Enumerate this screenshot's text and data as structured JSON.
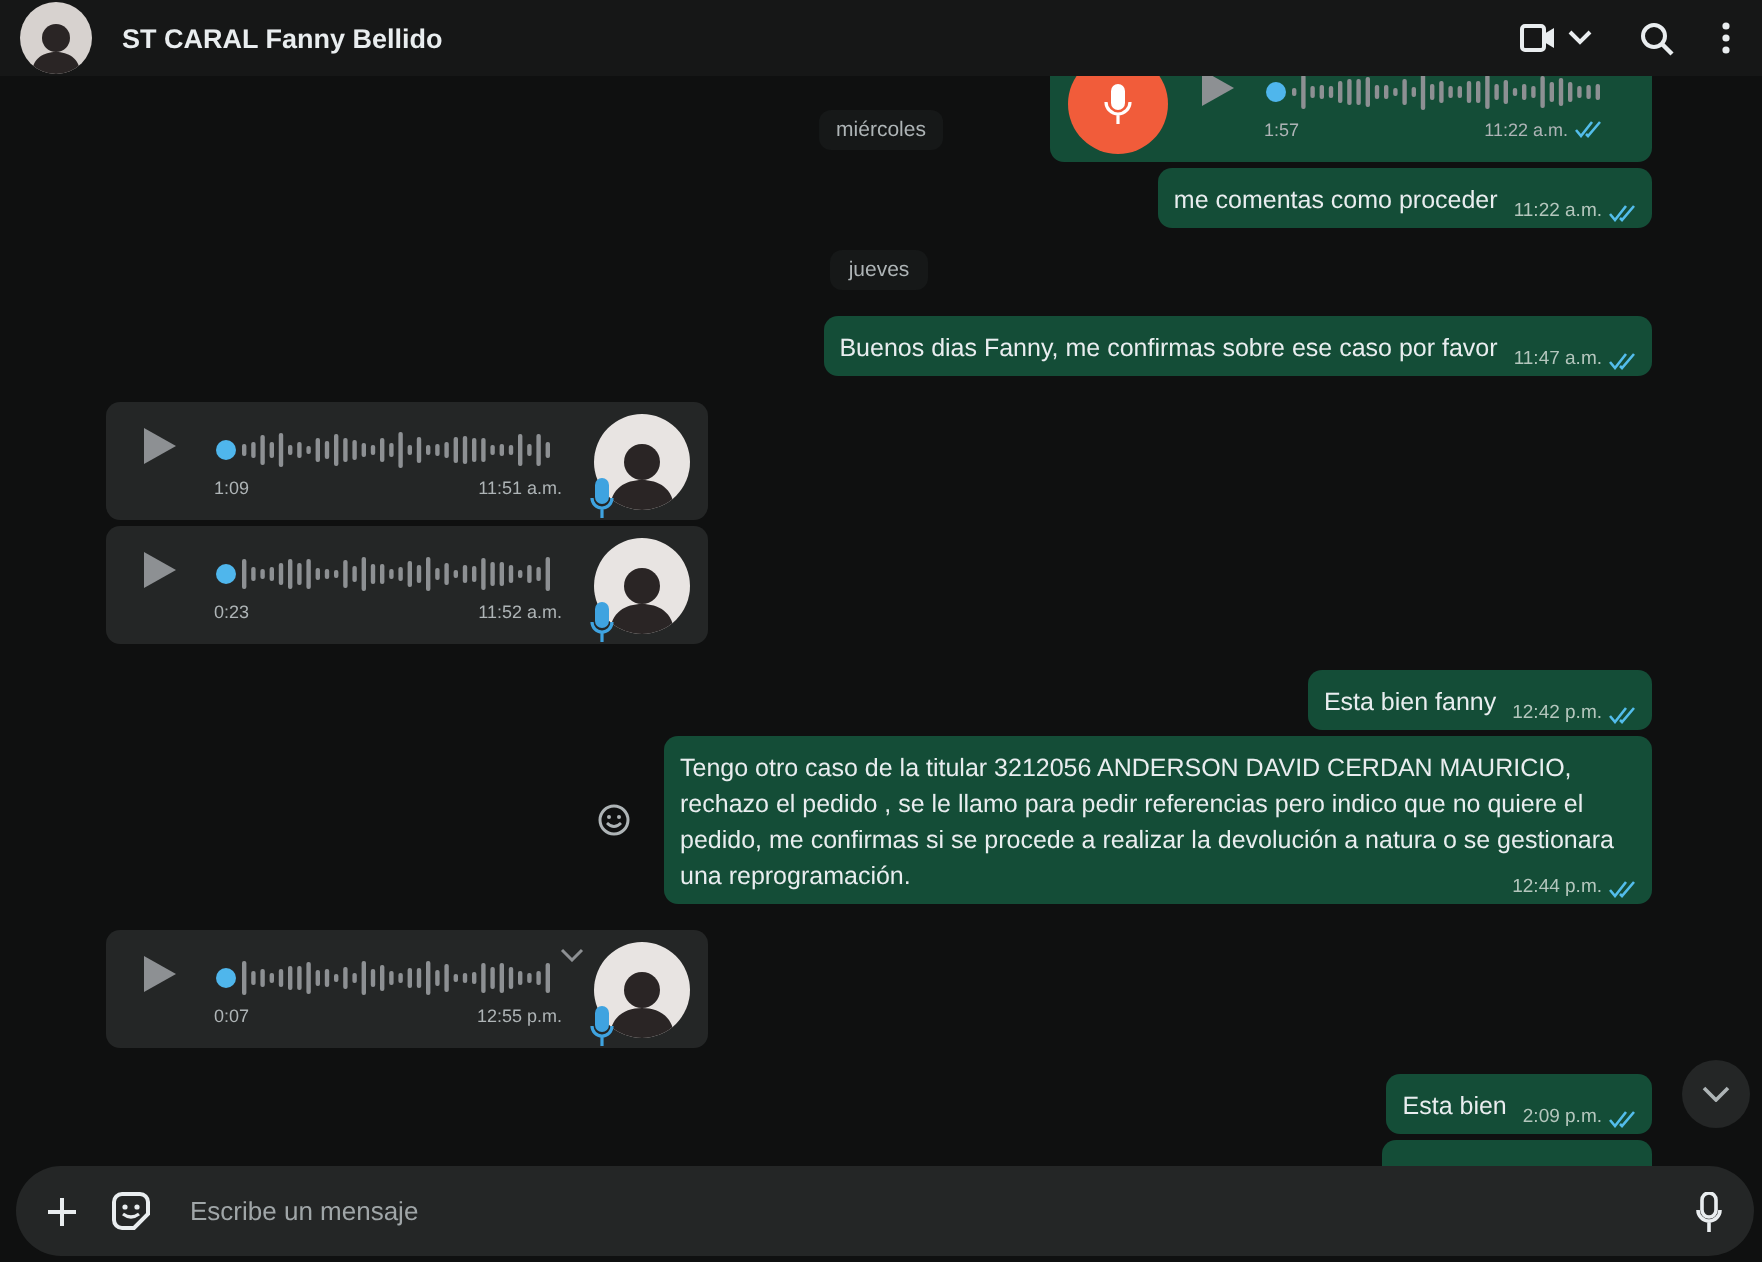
{
  "header": {
    "title": "ST CARAL Fanny Bellido"
  },
  "floating_date": "miércoles",
  "messages": [
    {
      "kind": "voice",
      "outgoing": true,
      "duration": "1:57",
      "time": "11:22 a.m.",
      "read": true
    },
    {
      "kind": "text",
      "outgoing": true,
      "text": "me comentas como proceder",
      "time": "11:22 a.m.",
      "read": true,
      "react_shown": false
    },
    {
      "kind": "date",
      "text": "jueves"
    },
    {
      "kind": "text",
      "outgoing": true,
      "text": "Buenos dias Fanny, me confirmas sobre ese caso por favor",
      "time": "11:47 a.m.",
      "read": true,
      "react_shown": false
    },
    {
      "kind": "voice",
      "outgoing": false,
      "duration": "1:09",
      "time": "11:51 a.m.",
      "menu_shown": false
    },
    {
      "kind": "voice",
      "outgoing": false,
      "duration": "0:23",
      "time": "11:52 a.m.",
      "menu_shown": false
    },
    {
      "kind": "text",
      "outgoing": true,
      "text": "Esta bien fanny",
      "time": "12:42 p.m.",
      "read": true,
      "react_shown": false
    },
    {
      "kind": "text",
      "outgoing": true,
      "text": "Tengo otro caso de la titular 3212056 ANDERSON DAVID CERDAN MAURICIO, rechazo el pedido , se le llamo para pedir referencias pero indico que no quiere el pedido, me confirmas si se procede a realizar la devolución a natura o se gestionara una reprogramación.",
      "time": "12:44 p.m.",
      "read": true,
      "react_shown": true
    },
    {
      "kind": "voice",
      "outgoing": false,
      "duration": "0:07",
      "time": "12:55 p.m.",
      "menu_shown": true
    },
    {
      "kind": "text",
      "outgoing": true,
      "text": "Esta bien",
      "time": "2:09 p.m.",
      "read": true,
      "react_shown": false
    },
    {
      "kind": "cut",
      "outgoing": true
    }
  ],
  "composer": {
    "placeholder": "Escribe un mensaje"
  }
}
